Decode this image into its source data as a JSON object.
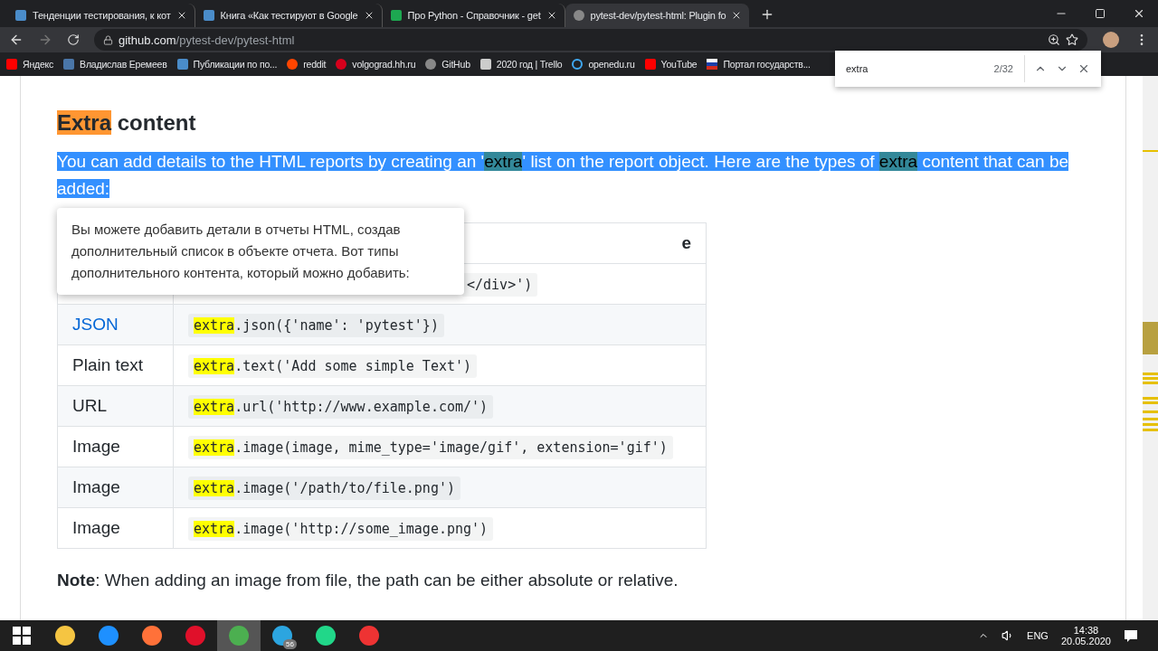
{
  "browser_tabs": [
    {
      "title": "Тенденции тестирования, к кот",
      "selected": false
    },
    {
      "title": "Книга «Как тестируют в Google",
      "selected": false
    },
    {
      "title": "Про Python - Справочник - get",
      "selected": false
    },
    {
      "title": "pytest-dev/pytest-html: Plugin fo",
      "selected": true
    }
  ],
  "address": {
    "host": "github.com",
    "path": "/pytest-dev/pytest-html"
  },
  "bookmarks": [
    {
      "label": "Яндекс"
    },
    {
      "label": "Владислав Еремеев"
    },
    {
      "label": "Публикации по по..."
    },
    {
      "label": "reddit"
    },
    {
      "label": "volgograd.hh.ru"
    },
    {
      "label": "GitHub"
    },
    {
      "label": "2020 год | Trello"
    },
    {
      "label": "openedu.ru"
    },
    {
      "label": "YouTube"
    },
    {
      "label": "Портал государств..."
    }
  ],
  "find_bar": {
    "value": "extra",
    "count": "2/32"
  },
  "heading": {
    "match": "Extra",
    "rest": " content"
  },
  "paragraph": [
    {
      "text": "You can add details to the HTML reports by creating an '",
      "match": false
    },
    {
      "text": "extra",
      "match": true
    },
    {
      "text": "' list on the report object. Here are the types of ",
      "match": false
    },
    {
      "text": "extra",
      "match": true
    },
    {
      "text": " content that can be added:",
      "match": false
    }
  ],
  "translation_popup": "Вы можете добавить детали в отчеты HTML, создав дополнительный список в объекте отчета. Вот типы дополнительного контента, который можно добавить:",
  "table": {
    "header": {
      "column_2": "e"
    },
    "rows": [
      {
        "code_rest": "</div>')"
      },
      {
        "type": "JSON",
        "link": true,
        "code_match": "extra",
        "code_rest": ".json({'name': 'pytest'})"
      },
      {
        "type": "Plain text",
        "link": false,
        "code_match": "extra",
        "code_rest": ".text('Add some simple Text')"
      },
      {
        "type": "URL",
        "link": false,
        "code_match": "extra",
        "code_rest": ".url('http://www.example.com/')"
      },
      {
        "type": "Image",
        "link": false,
        "code_match": "extra",
        "code_rest": ".image(image, mime_type='image/gif', extension='gif')"
      },
      {
        "type": "Image",
        "link": false,
        "code_match": "extra",
        "code_rest": ".image('/path/to/file.png')"
      },
      {
        "type": "Image",
        "link": false,
        "code_match": "extra",
        "code_rest": ".image('http://some_image.png')"
      }
    ]
  },
  "note": "**Note**: When adding an image from file, the path can be either absolute or relative.",
  "taskbar": {
    "apps": [
      {
        "active": false
      },
      {
        "active": false
      },
      {
        "active": false
      },
      {
        "active": false
      },
      {
        "active": true
      },
      {
        "active": false,
        "badge": "56"
      },
      {
        "active": false
      },
      {
        "active": false
      }
    ],
    "language": "ENG",
    "time": "14:38",
    "date": "20.05.2020"
  }
}
